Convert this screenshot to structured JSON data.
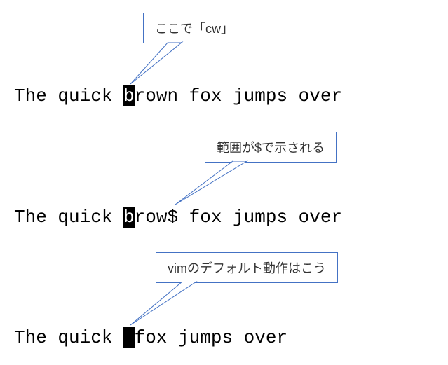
{
  "callouts": {
    "c1": "ここで「cw」",
    "c2": "範囲が$で示される",
    "c3": "vimのデフォルト動作はこう"
  },
  "lines": {
    "l1_pre": "The quick ",
    "l1_cur": "b",
    "l1_post": "rown fox jumps over",
    "l2_pre": "The quick ",
    "l2_cur": "b",
    "l2_post": "row$ fox jumps over",
    "l3_pre": "The quick ",
    "l3_cur": " ",
    "l3_post": "fox jumps over"
  }
}
